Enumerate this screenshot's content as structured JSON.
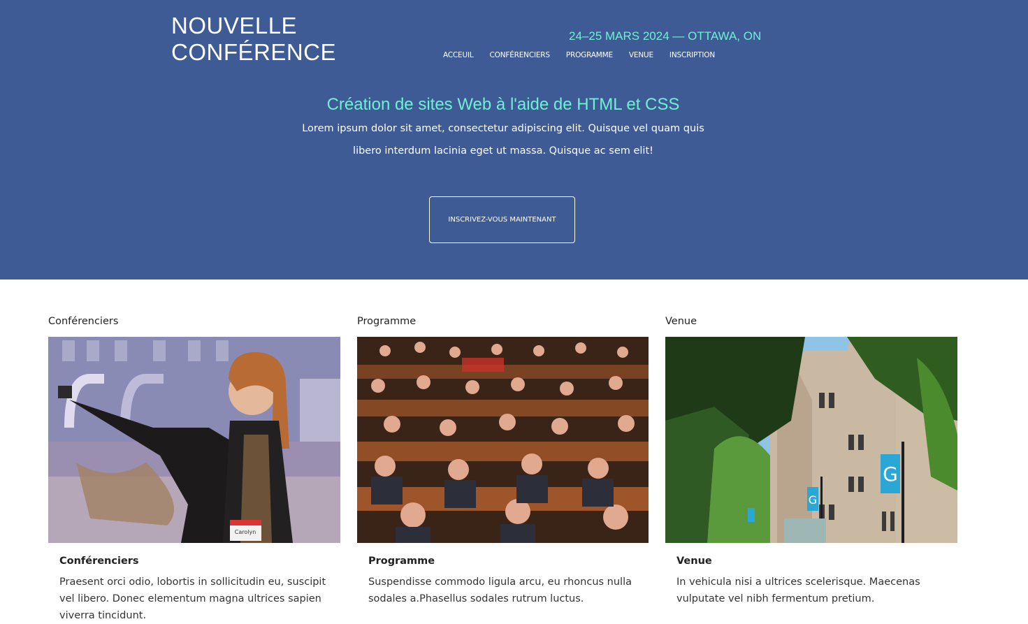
{
  "header": {
    "brand_line1": "NOUVELLE",
    "brand_line2": "CONFÉRENCE",
    "date_location": "24–25 MARS 2024 — OTTAWA, ON",
    "nav": [
      "ACCEUIL",
      "CONFÉRENCIERS",
      "PROGRAMME",
      "VENUE",
      "INSCRIPTION"
    ]
  },
  "hero": {
    "title": "Création de sites Web à l'aide de HTML et CSS",
    "text": "Lorem ipsum dolor sit amet, consectetur adipiscing elit. Quisque vel quam quis libero interdum lacinia eget ut massa. Quisque ac sem elit!",
    "cta_label": "INSCRIVEZ-VOUS MAINTENANT"
  },
  "cards": [
    {
      "heading": "Conférenciers",
      "title": "Conférenciers",
      "body": "Praesent orci odio, lobortis in sollicitudin eu, suscipit vel libero. Donec elementum magna ultrices sapien viverra tincidunt.",
      "image_icon": "speaker-photo",
      "badge_text": "Carolyn"
    },
    {
      "heading": "Programme",
      "title": "Programme",
      "body": "Suspendisse commodo ligula arcu, eu rhoncus nulla sodales a.Phasellus sodales rutrum luctus.",
      "image_icon": "audience-photo"
    },
    {
      "heading": "Venue",
      "title": "Venue",
      "body": "In vehicula nisi a ultrices scelerisque. Maecenas vulputate vel nibh fermentum pretium.",
      "image_icon": "venue-building-photo",
      "banner_letter": "G"
    }
  ],
  "colors": {
    "hero_bg": "#3f5b95",
    "accent": "#6ff0d4"
  }
}
